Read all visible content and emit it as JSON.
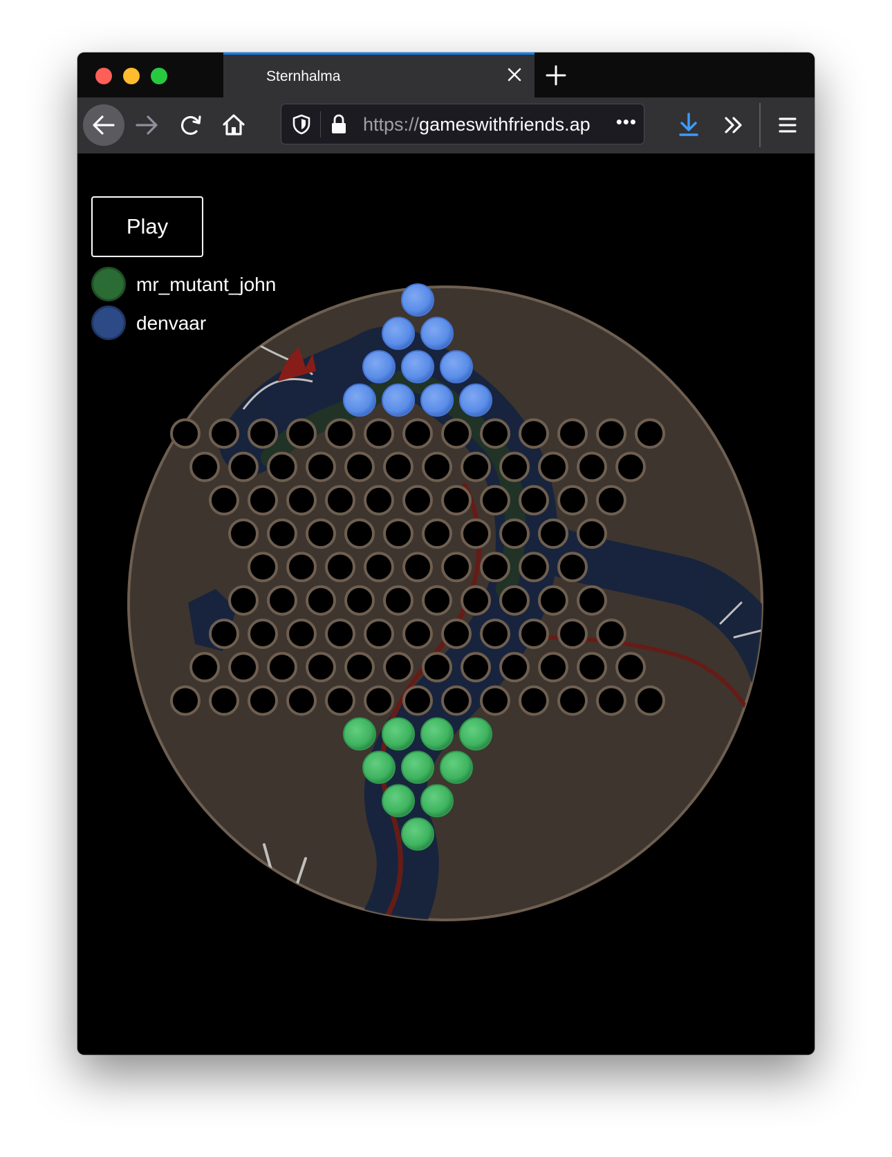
{
  "browser": {
    "tab_title": "Sternhalma",
    "url_prefix": "https://",
    "url_host": "gameswithfriends.ap",
    "url_more": "•••"
  },
  "game": {
    "play_label": "Play",
    "players": [
      {
        "name": "mr_mutant_john",
        "color": "#2b6b34"
      },
      {
        "name": "denvaar",
        "color": "#2c4a86"
      }
    ],
    "board_color": "#3e352f",
    "rim_color": "#6e5f50",
    "hole_fill": "#000000",
    "hole_ring": "#6e5f50",
    "blue_piece": "#5a8de8",
    "green_piece": "#3fb35f",
    "rows": [
      {
        "row": 0,
        "blue": [
          0
        ]
      },
      {
        "row": 1,
        "blue": [
          0,
          1
        ]
      },
      {
        "row": 2,
        "blue": [
          0,
          1,
          2
        ]
      },
      {
        "row": 3,
        "blue": [
          0,
          1,
          2,
          3
        ]
      },
      {
        "row": 13,
        "green": [
          0,
          1,
          2,
          3
        ]
      },
      {
        "row": 14,
        "green": [
          0,
          1,
          2
        ]
      },
      {
        "row": 15,
        "green": [
          0,
          1
        ]
      },
      {
        "row": 16,
        "green": [
          0
        ]
      }
    ]
  },
  "icons": {
    "back": "arrow-left-icon",
    "forward": "arrow-right-icon",
    "reload": "reload-icon",
    "home": "home-icon",
    "shield": "shield-icon",
    "lock": "lock-icon",
    "download": "download-icon",
    "overflow": "chevron-double-right-icon",
    "menu": "hamburger-menu-icon"
  }
}
